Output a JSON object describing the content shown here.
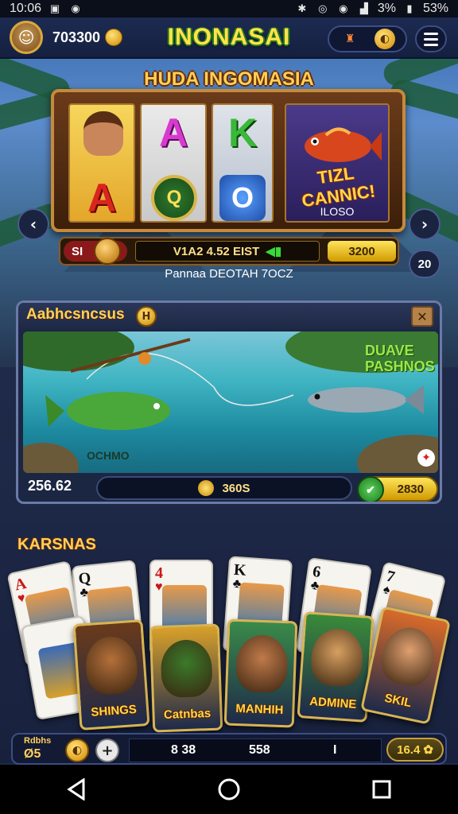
{
  "status_bar": {
    "time": "10:06",
    "battery": "53%",
    "signal_text": "3%"
  },
  "header": {
    "coins": "703300",
    "logo": "INONASAI"
  },
  "slot": {
    "title": "HUDA INGOMASIA",
    "reel1_letter": "A",
    "reel2_letter": "A",
    "reel2_coin": "Q",
    "reel3_letter": "K",
    "reel3_sym": "O",
    "reel4_text": "TIZL CANNIC!",
    "reel4_label": "ILOSO",
    "bet_label": "SI",
    "win_line": "V1A2 4.52 EIST",
    "spin_value": "3200",
    "subtitle": "Pannaa DEOTAH 7OCZ",
    "side_badge": "20"
  },
  "fishing": {
    "title": "Aabhcsncsus",
    "title_badge": "H",
    "scene_label_right": "DUAVE PASHNOS",
    "scene_label_left": "OCHMO",
    "score": "256.62",
    "bar_value": "360S",
    "button_value": "2830"
  },
  "cards": {
    "title": "KARSNAS",
    "small": [
      {
        "rank": "A",
        "suit": "♥",
        "color": "#c81818"
      },
      {
        "rank": "Q",
        "suit": "♣",
        "color": "#111111"
      },
      {
        "rank": "4",
        "suit": "♥",
        "color": "#c81818"
      },
      {
        "rank": "K",
        "suit": "♣",
        "color": "#111111"
      },
      {
        "rank": "6",
        "suit": "♣",
        "color": "#111111"
      },
      {
        "rank": "7",
        "suit": "♠",
        "color": "#111111"
      }
    ],
    "big": [
      {
        "label": "SHINGS",
        "bg": "#6a3a1a",
        "art": "#b5703a"
      },
      {
        "label": "Catnbas",
        "bg": "#d8a02a",
        "art": "#3a7a2a"
      },
      {
        "label": "MANHIH",
        "bg": "#3a8a4a",
        "art": "#c07a4a"
      },
      {
        "label": "ADMINE",
        "bg": "#3a8a3a",
        "art": "#d8a060"
      },
      {
        "label": "SKIL",
        "bg": "#d86a2a",
        "art": "#e0a070"
      }
    ]
  },
  "bottom_bar": {
    "small_label": "Rdbhs",
    "big_label": "Ø5",
    "coin_glyph": "◐",
    "plus_glyph": "+",
    "val1": "8 38",
    "val2": "558",
    "val3": "I",
    "right_value": "16.4"
  },
  "colors": {
    "accent_gold": "#ffd05a",
    "logo_green": "#2b7a1b",
    "panel_bg": "#1b2642"
  }
}
